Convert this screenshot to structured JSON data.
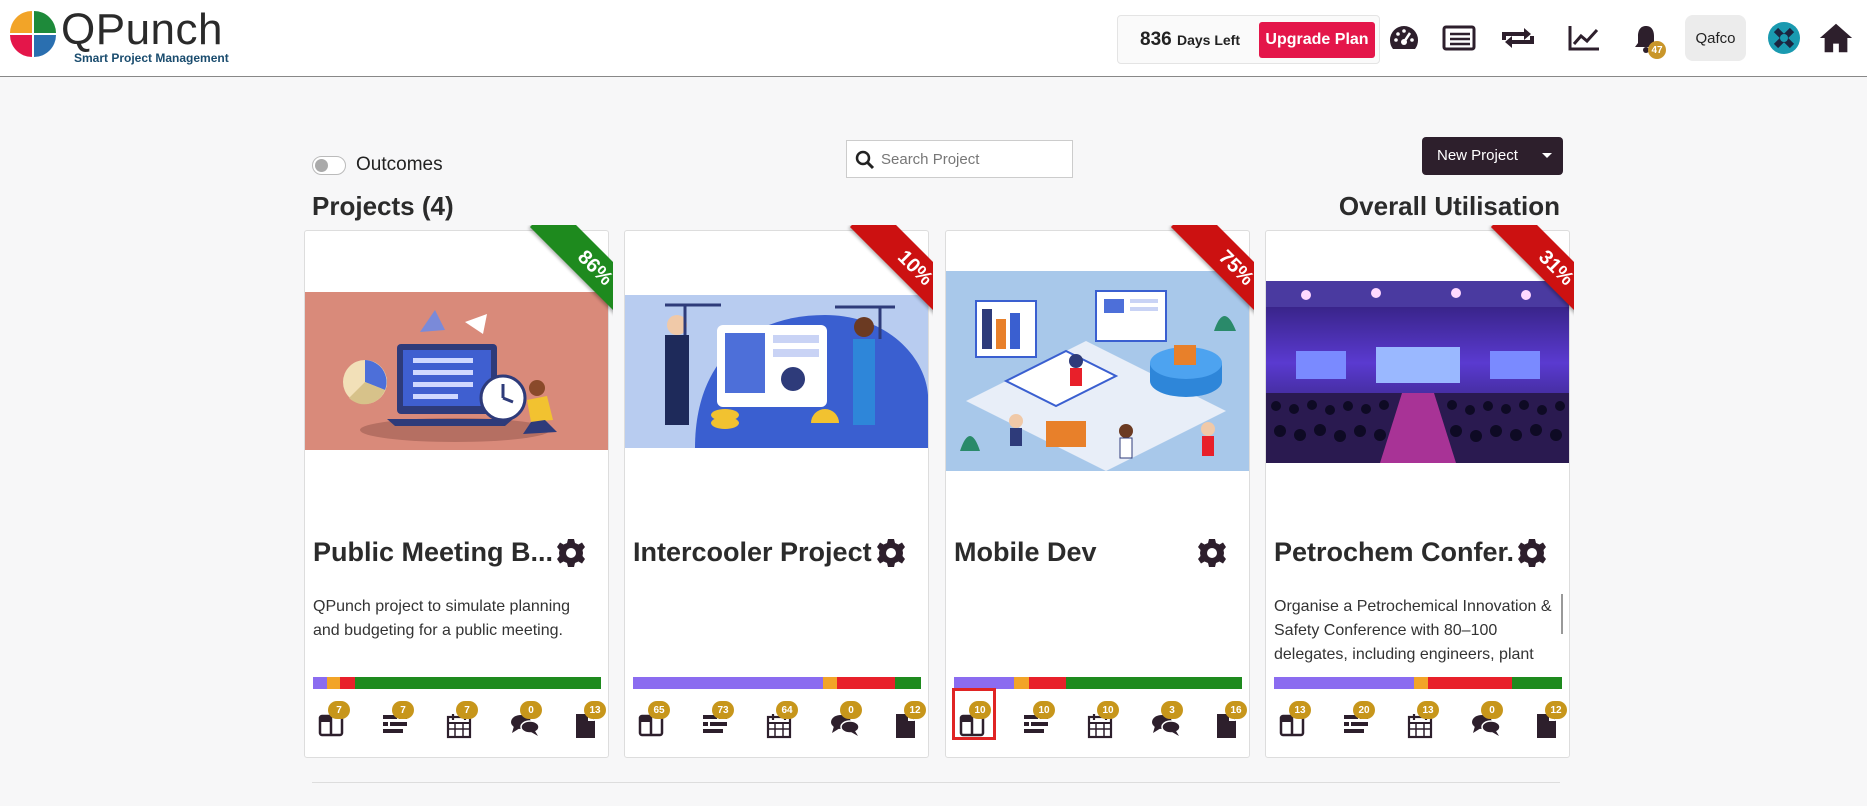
{
  "header": {
    "logo_text": "QPunch",
    "logo_sub": "Smart Project Management",
    "days_left_value": "836",
    "days_left_label": "Days Left",
    "upgrade_label": "Upgrade Plan",
    "notifications_count": "47",
    "user_label": "Qafco",
    "icons": [
      "dashboard-icon",
      "list-icon",
      "exchange-icon",
      "chart-line-icon",
      "bell-icon",
      "company-logo-icon",
      "home-icon"
    ]
  },
  "toolbar": {
    "outcomes_label": "Outcomes",
    "search_placeholder": "Search Project",
    "new_project_label": "New Project"
  },
  "sections": {
    "projects_title": "Projects (4)",
    "utilisation_title": "Overall Utilisation"
  },
  "colors": {
    "ribbon_green": "#1e8a1e",
    "ribbon_red": "#cc1111",
    "purple": "#8b6cf0",
    "orange": "#f2a428",
    "red": "#e8202a",
    "green": "#1e8a1e",
    "badge": "#c7961b",
    "upgrade": "#e4164a"
  },
  "projects": [
    {
      "title": "Public Meeting B...",
      "percent": "86%",
      "ribbon": "green",
      "description": "QPunch project to simulate planning and budgeting for a public meeting.",
      "progress": [
        [
          "purple",
          0.05
        ],
        [
          "orange",
          0.045
        ],
        [
          "red",
          0.05
        ],
        [
          "green",
          0.855
        ]
      ],
      "counts": [
        "7",
        "7",
        "7",
        "0",
        "13"
      ]
    },
    {
      "title": "Intercooler Project",
      "percent": "10%",
      "ribbon": "red",
      "description": "",
      "progress": [
        [
          "purple",
          0.66
        ],
        [
          "orange",
          0.05
        ],
        [
          "red",
          0.2
        ],
        [
          "green",
          0.09
        ]
      ],
      "counts": [
        "65",
        "73",
        "64",
        "0",
        "12"
      ]
    },
    {
      "title": "Mobile Dev",
      "percent": "75%",
      "ribbon": "red",
      "description": "",
      "progress": [
        [
          "purple",
          0.21
        ],
        [
          "orange",
          0.05
        ],
        [
          "red",
          0.13
        ],
        [
          "green",
          0.61
        ]
      ],
      "counts": [
        "10",
        "10",
        "10",
        "3",
        "16"
      ]
    },
    {
      "title": "Petrochem Confer...",
      "percent": "31%",
      "ribbon": "red",
      "description": "Organise a Petrochemical Innovation & Safety Conference with 80–100 delegates, including engineers, plant",
      "progress": [
        [
          "purple",
          0.485
        ],
        [
          "orange",
          0.05
        ],
        [
          "red",
          0.29
        ],
        [
          "green",
          0.175
        ]
      ],
      "counts": [
        "13",
        "20",
        "13",
        "0",
        "12"
      ]
    }
  ],
  "card_icon_names": [
    "panels-icon",
    "gantt-icon",
    "calendar-icon",
    "chat-icon",
    "document-icon"
  ]
}
